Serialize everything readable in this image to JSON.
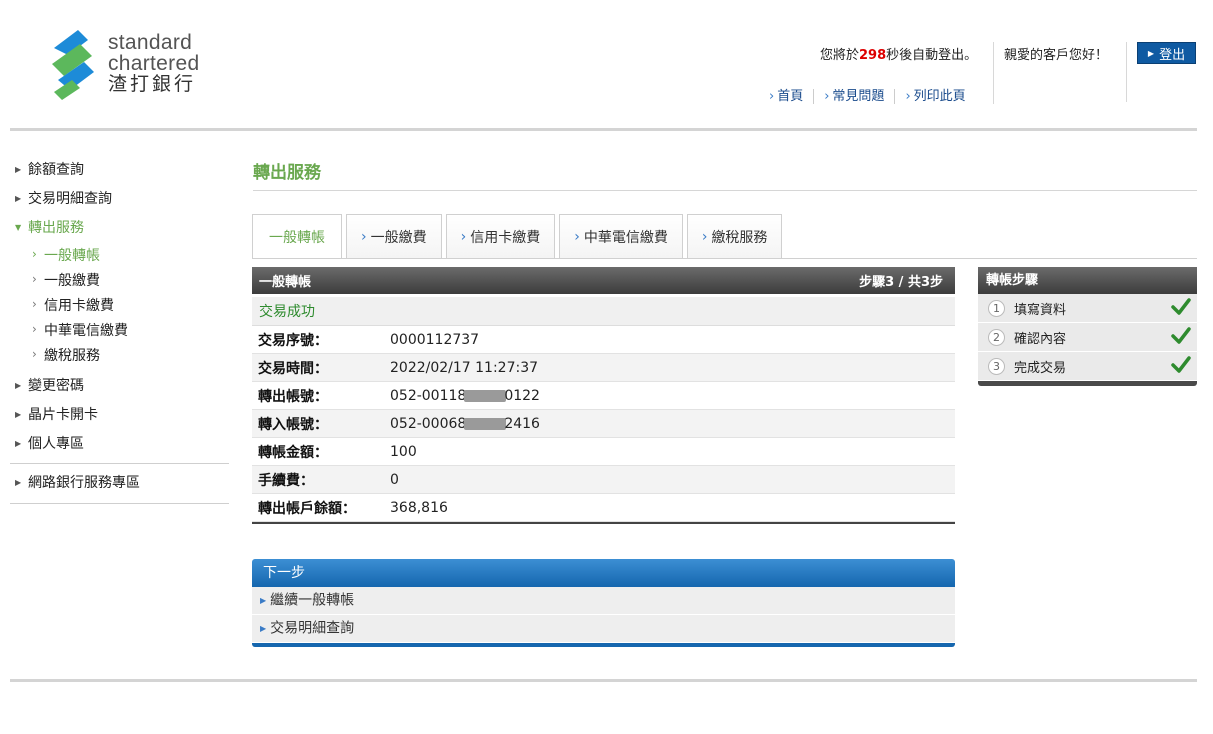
{
  "brand": {
    "name_line1": "standard",
    "name_line2": "chartered",
    "name_cn": "渣打銀行",
    "colors": {
      "blue": "#0f5aa2",
      "green": "#6aa84f"
    }
  },
  "header": {
    "autologout_prefix": "您將於",
    "autologout_seconds": "298",
    "autologout_suffix": "秒後自動登出。",
    "greeting": "親愛的客戶您好！",
    "logout_label": "登出",
    "links": [
      "首頁",
      "常見問題",
      "列印此頁"
    ]
  },
  "sidebar": {
    "items": [
      {
        "label": "餘額查詢"
      },
      {
        "label": "交易明細查詢"
      },
      {
        "label": "轉出服務"
      }
    ],
    "subitems": [
      "一般轉帳",
      "一般繳費",
      "信用卡繳費",
      "中華電信繳費",
      "繳稅服務"
    ],
    "items2": [
      {
        "label": "變更密碼"
      },
      {
        "label": "晶片卡開卡"
      },
      {
        "label": "個人專區"
      }
    ],
    "bottom_item": "網路銀行服務專區"
  },
  "main": {
    "page_title": "轉出服務",
    "tabs": [
      "一般轉帳",
      "一般繳費",
      "信用卡繳費",
      "中華電信繳費",
      "繳稅服務"
    ],
    "panel_title": "一般轉帳",
    "step_indicator": "步驟3 / 共3步",
    "result": "交易成功",
    "rows": [
      {
        "label": "交易序號：",
        "value": "0000112737"
      },
      {
        "label": "交易時間：",
        "value": "2022/02/17 11:27:37"
      },
      {
        "label": "轉出帳號：",
        "value_pre": "052-00118",
        "value_post": "0122"
      },
      {
        "label": "轉入帳號：",
        "value_pre": "052-00068",
        "value_post": "2416"
      },
      {
        "label": "轉帳金額：",
        "value": "100"
      },
      {
        "label": "手續費：",
        "value": "0"
      },
      {
        "label": "轉出帳戶餘額：",
        "value": "368,816"
      }
    ]
  },
  "steps": {
    "title": "轉帳步驟",
    "items": [
      {
        "num": "1",
        "label": "填寫資料"
      },
      {
        "num": "2",
        "label": "確認內容"
      },
      {
        "num": "3",
        "label": "完成交易"
      }
    ]
  },
  "next": {
    "title": "下一步",
    "items": [
      "繼續一般轉帳",
      "交易明細查詢"
    ]
  }
}
